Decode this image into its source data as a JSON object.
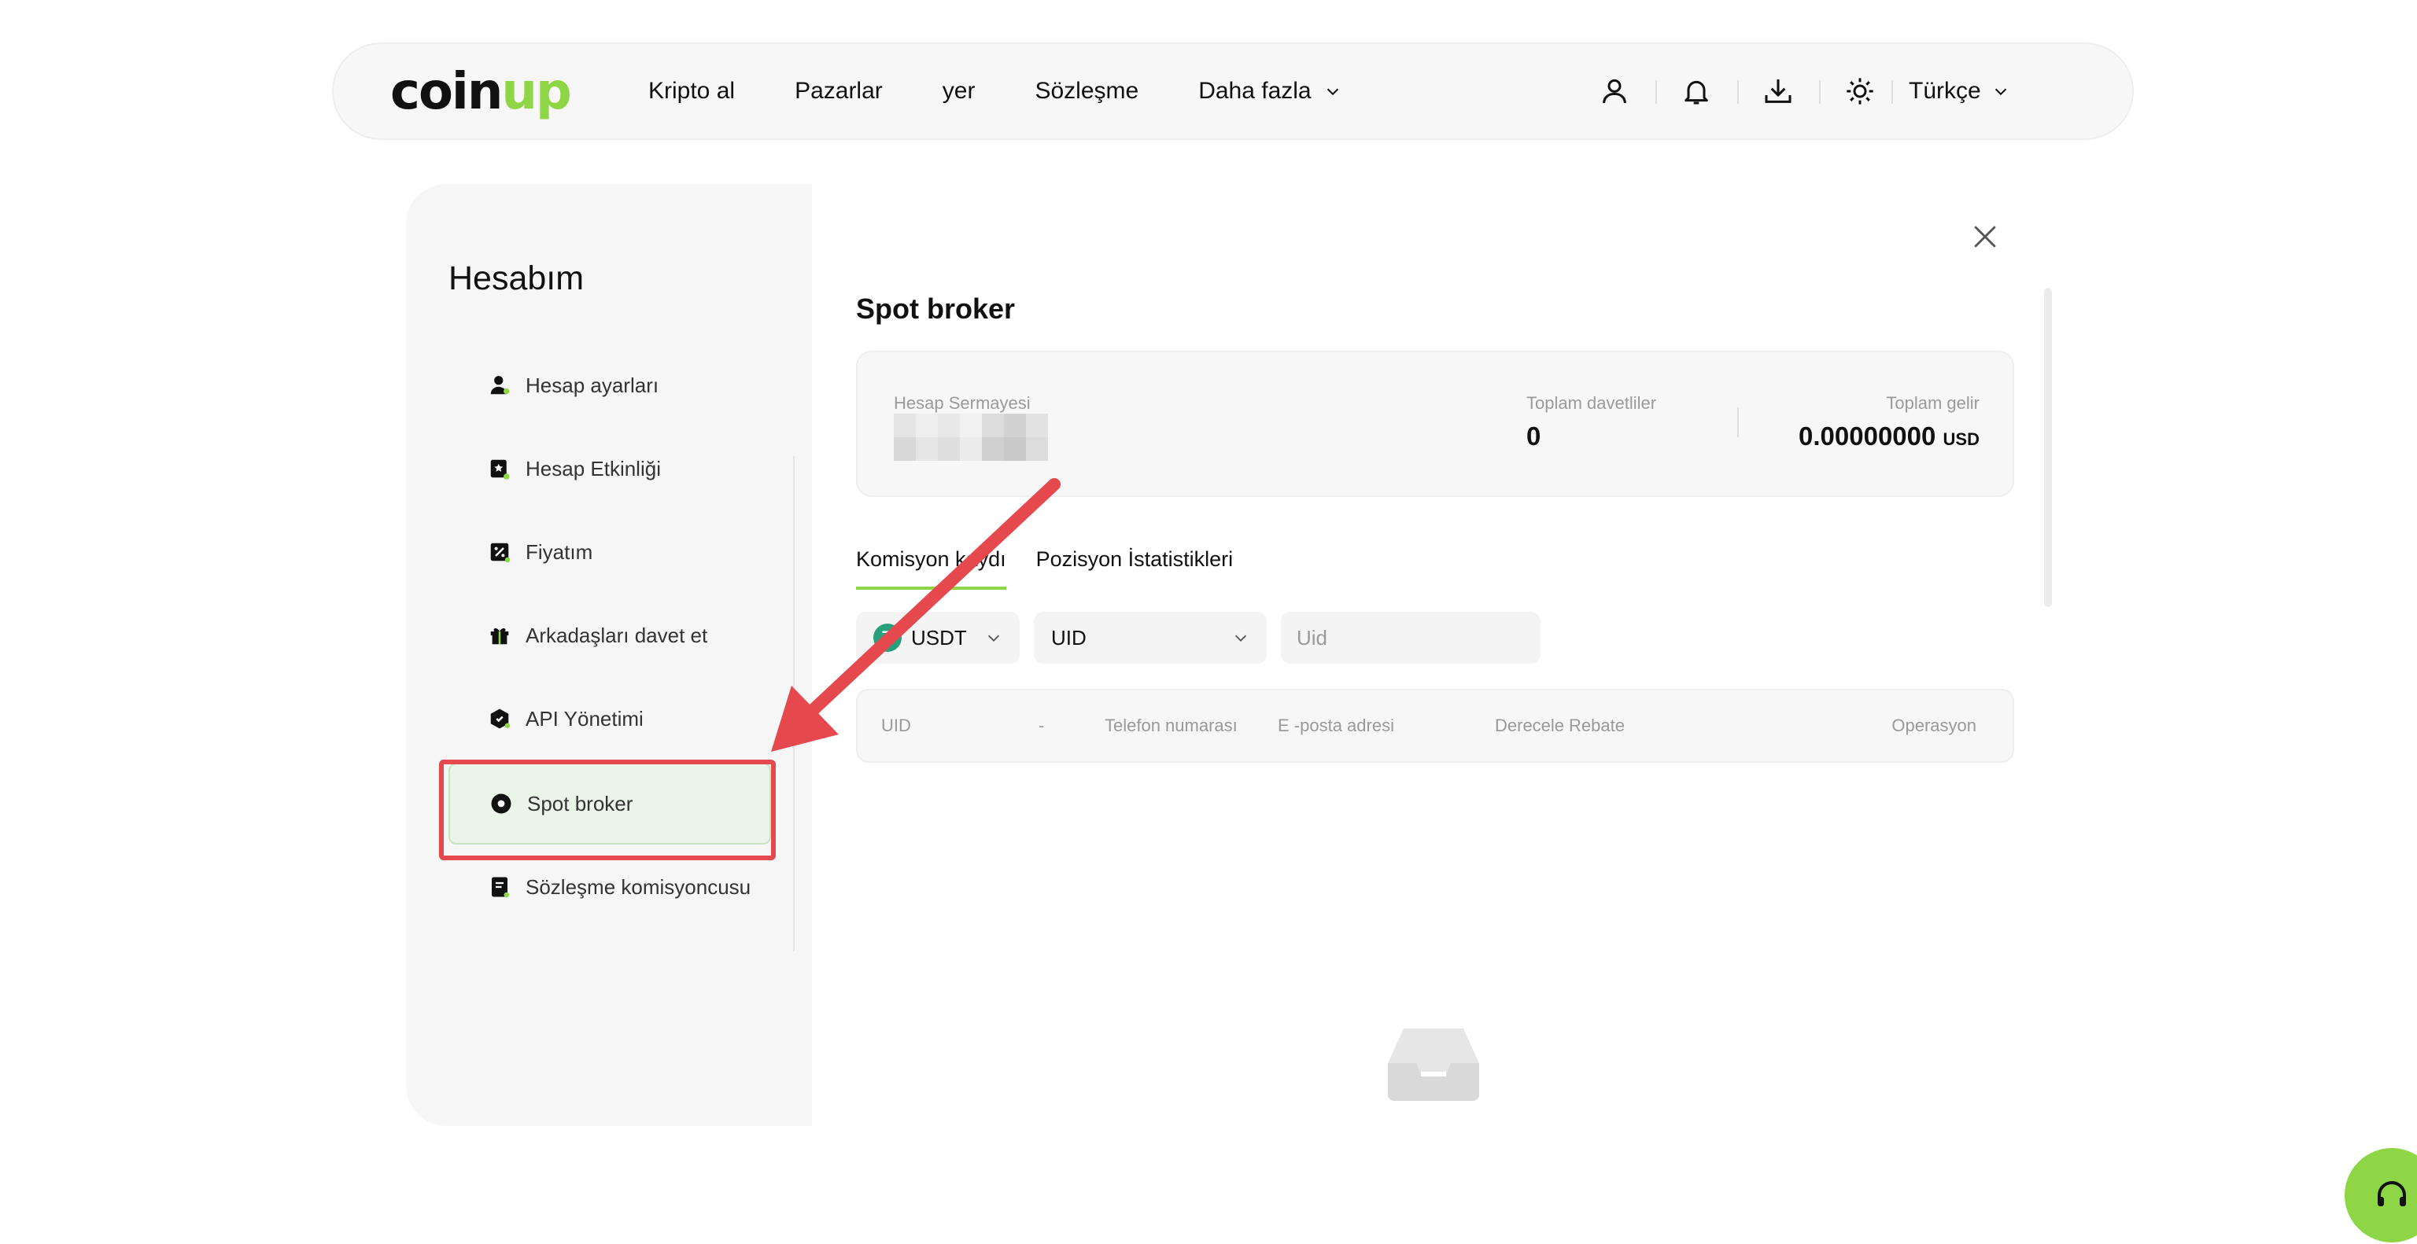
{
  "header": {
    "logo": {
      "part1": "coin",
      "part2": "up"
    },
    "nav": [
      {
        "label": "Kripto al"
      },
      {
        "label": "Pazarlar"
      },
      {
        "label": "yer"
      },
      {
        "label": "Sözleşme"
      },
      {
        "label": "Daha fazla"
      }
    ],
    "icons": [
      "user-icon",
      "bell-icon",
      "download-icon",
      "sun-icon"
    ],
    "language": "Türkçe"
  },
  "sidebar": {
    "title": "Hesabım",
    "items": [
      {
        "label": "Hesap ayarları",
        "icon": "user-settings-icon"
      },
      {
        "label": "Hesap Etkinliği",
        "icon": "activity-icon"
      },
      {
        "label": "Fiyatım",
        "icon": "percent-icon"
      },
      {
        "label": "Arkadaşları davet et",
        "icon": "gift-icon"
      },
      {
        "label": "API Yönetimi",
        "icon": "api-icon"
      },
      {
        "label": "Spot broker",
        "icon": "broker-icon",
        "active": true
      },
      {
        "label": "Sözleşme komisyoncusu",
        "icon": "contract-icon"
      }
    ]
  },
  "main": {
    "title": "Spot broker",
    "stats": {
      "capital_label": "Hesap Sermayesi",
      "invites_label": "Toplam davetliler",
      "invites_value": "0",
      "income_label": "Toplam gelir",
      "income_value": "0.00000000",
      "income_unit": "USD"
    },
    "tabs": [
      {
        "label": "Komisyon kaydı",
        "active": true
      },
      {
        "label": "Pozisyon İstatistikleri"
      }
    ],
    "filters": {
      "coin": "USDT",
      "coin_glyph": "₮",
      "field": "UID",
      "uid_placeholder": "Uid"
    },
    "table_headers": [
      "UID",
      "-",
      "Telefon numarası",
      "E -posta adresi",
      "Derecele",
      "Rebate",
      "Operasyon"
    ]
  },
  "colors": {
    "accent": "#8fd646",
    "annotation": "#e5484d"
  }
}
